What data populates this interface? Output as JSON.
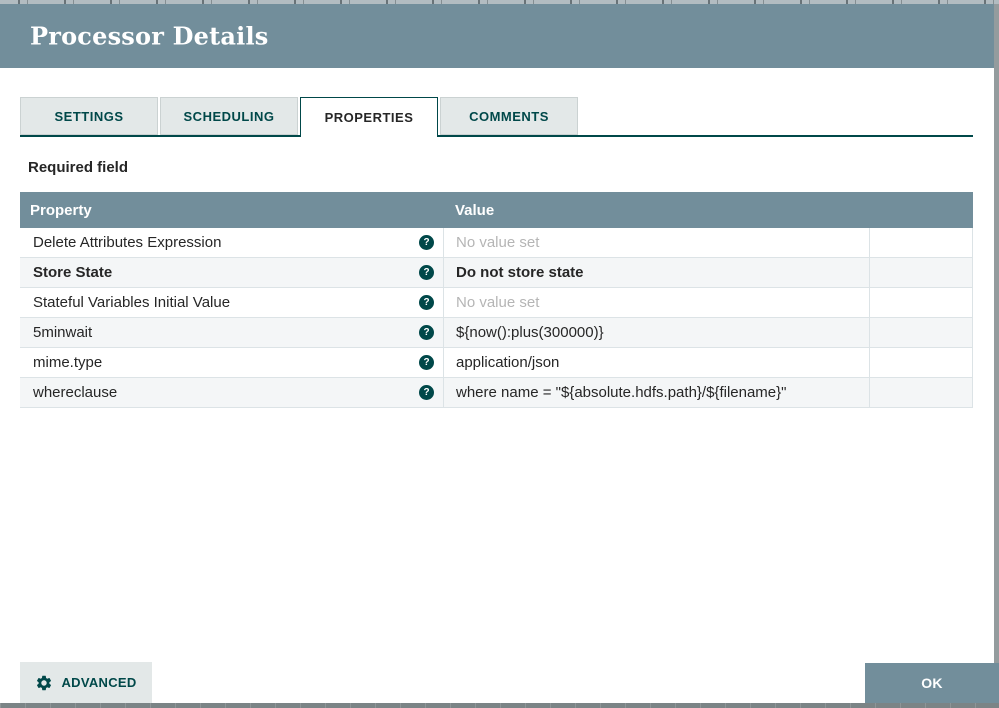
{
  "page": {
    "title": "Processor Details"
  },
  "tabs": [
    {
      "label": "SETTINGS",
      "active": false
    },
    {
      "label": "SCHEDULING",
      "active": false
    },
    {
      "label": "PROPERTIES",
      "active": true
    },
    {
      "label": "COMMENTS",
      "active": false
    }
  ],
  "required_note": "Required field",
  "properties_table": {
    "columns": {
      "property": "Property",
      "value": "Value"
    },
    "help_icon_glyph": "?",
    "rows": [
      {
        "property": "Delete Attributes Expression",
        "value": "No value set",
        "unset": true,
        "emphasis": false
      },
      {
        "property": "Store State",
        "value": "Do not store state",
        "unset": false,
        "emphasis": true
      },
      {
        "property": "Stateful Variables Initial Value",
        "value": "No value set",
        "unset": true,
        "emphasis": false
      },
      {
        "property": "5minwait",
        "value": "${now():plus(300000)}",
        "unset": false,
        "emphasis": false
      },
      {
        "property": "mime.type",
        "value": "application/json",
        "unset": false,
        "emphasis": false
      },
      {
        "property": "whereclause",
        "value": "where name = \"${absolute.hdfs.path}/${filename}\"",
        "unset": false,
        "emphasis": false
      }
    ]
  },
  "footer": {
    "advanced_label": "ADVANCED",
    "ok_label": "OK"
  },
  "colors": {
    "accent": "#728e9b",
    "teal": "#004849",
    "alt_row": "#f4f6f7",
    "unset_text": "#b5b5b5"
  }
}
